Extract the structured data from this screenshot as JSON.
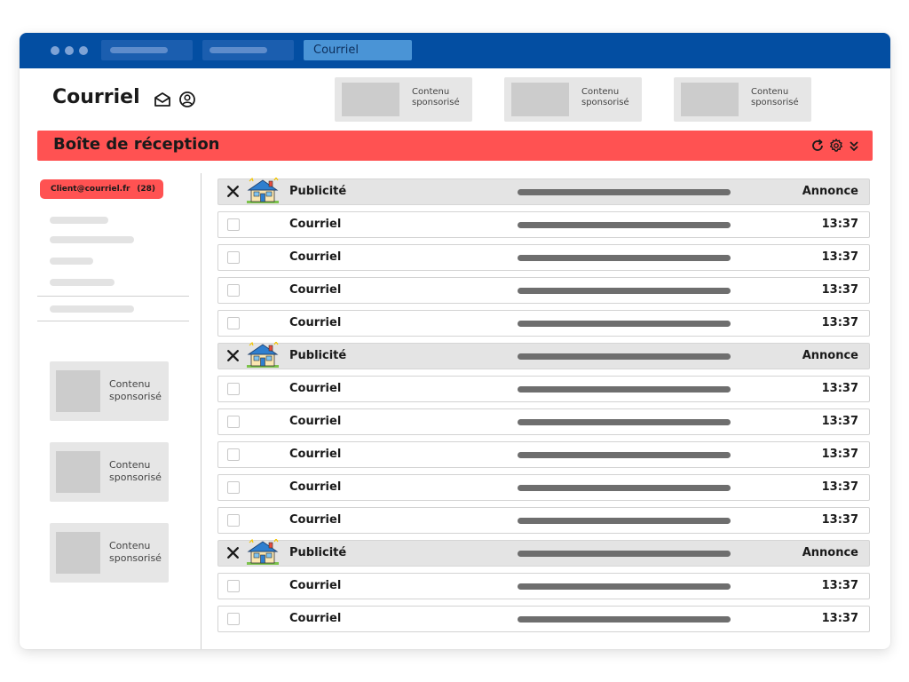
{
  "browser": {
    "active_tab": "Courriel"
  },
  "header": {
    "title": "Courriel",
    "icons": [
      "envelope-open-icon",
      "user-circle-icon"
    ],
    "sponsored": [
      {
        "label": "Contenu sponsorisé"
      },
      {
        "label": "Contenu sponsorisé"
      },
      {
        "label": "Contenu sponsorisé"
      }
    ]
  },
  "inbox": {
    "title": "Boîte de réception",
    "icons": [
      "refresh-icon",
      "gear-icon",
      "chevron-double-down-icon"
    ],
    "accent_color": "#ff5252"
  },
  "sidebar": {
    "account_email": "Client@courriel.fr",
    "account_count": "(28)",
    "sponsored": [
      {
        "label": "Contenu sponsorisé"
      },
      {
        "label": "Contenu sponsorisé"
      },
      {
        "label": "Contenu sponsorisé"
      }
    ]
  },
  "messages": [
    {
      "type": "ad",
      "sender": "Publicité",
      "meta": "Annonce"
    },
    {
      "type": "mail",
      "sender": "Courriel",
      "meta": "13:37"
    },
    {
      "type": "mail",
      "sender": "Courriel",
      "meta": "13:37"
    },
    {
      "type": "mail",
      "sender": "Courriel",
      "meta": "13:37"
    },
    {
      "type": "mail",
      "sender": "Courriel",
      "meta": "13:37"
    },
    {
      "type": "ad",
      "sender": "Publicité",
      "meta": "Annonce"
    },
    {
      "type": "mail",
      "sender": "Courriel",
      "meta": "13:37"
    },
    {
      "type": "mail",
      "sender": "Courriel",
      "meta": "13:37"
    },
    {
      "type": "mail",
      "sender": "Courriel",
      "meta": "13:37"
    },
    {
      "type": "mail",
      "sender": "Courriel",
      "meta": "13:37"
    },
    {
      "type": "mail",
      "sender": "Courriel",
      "meta": "13:37"
    },
    {
      "type": "ad",
      "sender": "Publicité",
      "meta": "Annonce"
    },
    {
      "type": "mail",
      "sender": "Courriel",
      "meta": "13:37"
    },
    {
      "type": "mail",
      "sender": "Courriel",
      "meta": "13:37"
    }
  ],
  "colors": {
    "titlebar": "#034ea2",
    "accent": "#ff5252",
    "ad_row": "#e4e4e4"
  }
}
